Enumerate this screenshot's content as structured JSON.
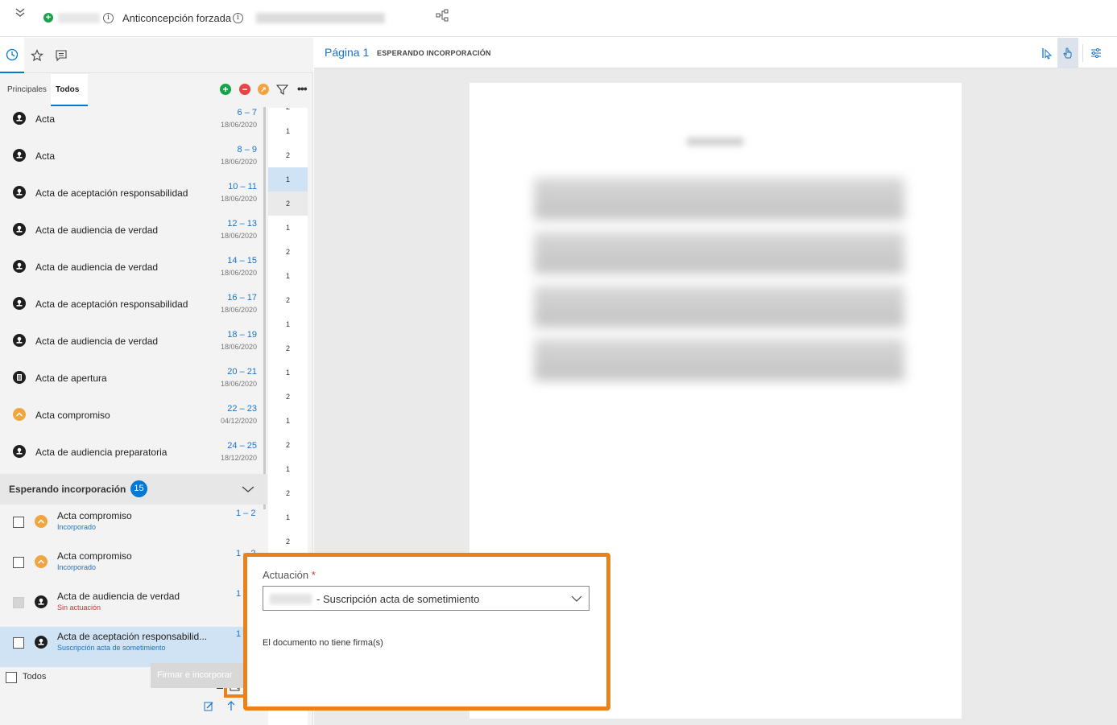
{
  "topbar": {
    "title": "Anticoncepción forzada",
    "icons": [
      "chevron-double-down-icon",
      "add-circle-icon",
      "info-icon",
      "tree-icon"
    ]
  },
  "left": {
    "tabs": [
      {
        "label": "Principales"
      },
      {
        "label": "Todos"
      }
    ],
    "documents": [
      {
        "name": "Acta",
        "pages": "6 – 7",
        "date": "18/06/2020",
        "icon": "stamp-icon",
        "color": "#1f1f1f"
      },
      {
        "name": "Acta",
        "pages": "8 – 9",
        "date": "18/06/2020",
        "icon": "stamp-icon",
        "color": "#1f1f1f"
      },
      {
        "name": "Acta de aceptación responsabilidad",
        "pages": "10 – 11",
        "date": "18/06/2020",
        "icon": "stamp-icon",
        "color": "#1f1f1f"
      },
      {
        "name": "Acta de audiencia de verdad",
        "pages": "12 – 13",
        "date": "18/06/2020",
        "icon": "stamp-icon",
        "color": "#1f1f1f"
      },
      {
        "name": "Acta de audiencia de verdad",
        "pages": "14 – 15",
        "date": "18/06/2020",
        "icon": "stamp-icon",
        "color": "#1f1f1f"
      },
      {
        "name": "Acta de aceptación responsabilidad",
        "pages": "16 – 17",
        "date": "18/06/2020",
        "icon": "stamp-icon",
        "color": "#1f1f1f"
      },
      {
        "name": "Acta de audiencia de verdad",
        "pages": "18 – 19",
        "date": "18/06/2020",
        "icon": "stamp-icon",
        "color": "#1f1f1f"
      },
      {
        "name": "Acta de apertura",
        "pages": "20 – 21",
        "date": "18/06/2020",
        "icon": "document-icon",
        "color": "#1f1f1f"
      },
      {
        "name": "Acta compromiso",
        "pages": "22 – 23",
        "date": "04/12/2020",
        "icon": "handshake-icon",
        "color": "#f0a640"
      },
      {
        "name": "Acta de audiencia preparatoria",
        "pages": "24 – 25",
        "date": "18/12/2020",
        "icon": "stamp-icon",
        "color": "#1f1f1f"
      }
    ],
    "page_numbers": [
      "2",
      "1",
      "2",
      "1",
      "2",
      "1",
      "2",
      "1",
      "2",
      "1",
      "2",
      "1",
      "2",
      "1",
      "2",
      "1",
      "2",
      "1",
      "2",
      "1",
      "2",
      "1",
      "2",
      "1",
      "2"
    ],
    "pending": {
      "title": "Esperando incorporación",
      "count": "15",
      "items": [
        {
          "name": "Acta compromiso",
          "status": "Incorporado",
          "status_color": "#1a73c7",
          "pages": "1 – 2",
          "icon": "handshake-icon",
          "color": "#f0a640",
          "checkbox_enabled": true
        },
        {
          "name": "Acta compromiso",
          "status": "Incorporado",
          "status_color": "#1a73c7",
          "pages": "1 – 2",
          "icon": "handshake-icon",
          "color": "#f0a640",
          "checkbox_enabled": true
        },
        {
          "name": "Acta de audiencia de verdad",
          "status": "Sin actuación",
          "status_color": "#d13438",
          "pages": "1",
          "icon": "stamp-icon",
          "color": "#1f1f1f",
          "checkbox_enabled": false
        },
        {
          "name": "Acta de aceptación responsabilid...",
          "status": "Suscripción acta de sometimiento",
          "status_color": "#1a73c7",
          "pages": "1",
          "icon": "stamp-icon",
          "color": "#1f1f1f",
          "checkbox_enabled": true
        }
      ]
    },
    "footer": {
      "select_all_label": "Todos",
      "sign_button": "Firmar e incorporar"
    }
  },
  "viewer": {
    "page_label": "Página 1",
    "status": "ESPERANDO INCORPORACIÓN"
  },
  "popup": {
    "field_label": "Actuación",
    "required_mark": "*",
    "selected_value": "- Suscripción acta de sometimiento",
    "message": "El documento no tiene firma(s)"
  },
  "colors": {
    "accent": "#0078d4",
    "highlight": "#e8821c",
    "selected_row": "#cfe3f5"
  }
}
